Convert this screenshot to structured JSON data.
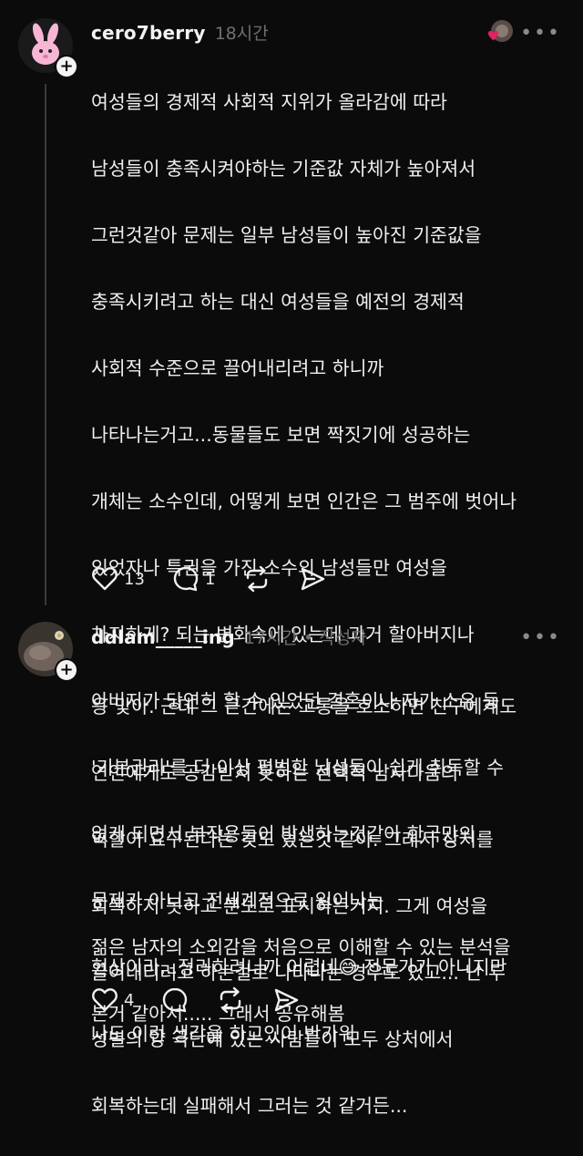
{
  "comments": [
    {
      "username": "cero7berry",
      "time": "18시간",
      "text_lines": [
        "여성들의 경제적 사회적 지위가 올라감에 따라",
        "남성들이 충족시켜야하는 기준값 자체가 높아져서",
        "그런것같아 문제는 일부 남성들이 높아진 기준값을",
        "충족시키려고 하는 대신 여성들을 예전의 경제적",
        "사회적 수준으로 끌어내리려고 하니까",
        "나타나는거고...동물들도 보면 짝짓기에 성공하는",
        "개체는 소수인데, 어떻게 보면 인간은 그 범주에 벗어나",
        "있었자나 특권을 가진 소수의 남성들만 여성을",
        "차지하게? 되는 변화속에 있는데 과거 할아버지나",
        "아버지가 당연히 할 수 있었던 결혼이나 자가 소유 등",
        "'기본권리'를 더 이상 평범한 남성들이 쉽게 취득할 수",
        "없게 되면서 부작용들이 발생하는것같아 한국만의",
        "문제가 아니고 전세계적으로 일어나는",
        "현상이라...정리하려니까 어렵네😅 전문가가 아니지만",
        "나도 이런 생각을 하고있어 반가워"
      ],
      "likes": "13",
      "replies": "1",
      "icons": [
        "heart-icon",
        "comment-icon",
        "repost-icon",
        "share-icon"
      ]
    },
    {
      "username": "ddlam_____ing",
      "time": "17시간 • 작성자",
      "text_lines": [
        "응 맞아. 근데 그 근간에는 고통을 호소하면 친구에게도",
        "연인에게도 공감받지 못하는 선택적 남자다움의",
        "역할이 요구된다는 것도 있는것 같아. 그래서 상처를",
        "회복하지 못하고 분노로 표시하는거지. 그게 여성을",
        "끌어내리려고 하는걸로 나타나는 경우도 있고... 난 두",
        "성별의 양 극단에 있는 사람들이 모두 상처에서",
        "회복하는데 실패해서 그러는 것 같거든..."
      ],
      "text_lines_2": [
        "젊은 남자의 소외감을 처음으로 이해할 수 있는 분석을",
        "본거 같아서..... 그래서 공유해봄"
      ],
      "likes": "4",
      "icons": [
        "heart-icon",
        "comment-icon",
        "repost-icon",
        "share-icon"
      ]
    }
  ],
  "colors": {
    "background": "#0b0b0b",
    "text": "#efefef",
    "muted": "#6f6f6f",
    "like_heart": "#e0245e"
  }
}
